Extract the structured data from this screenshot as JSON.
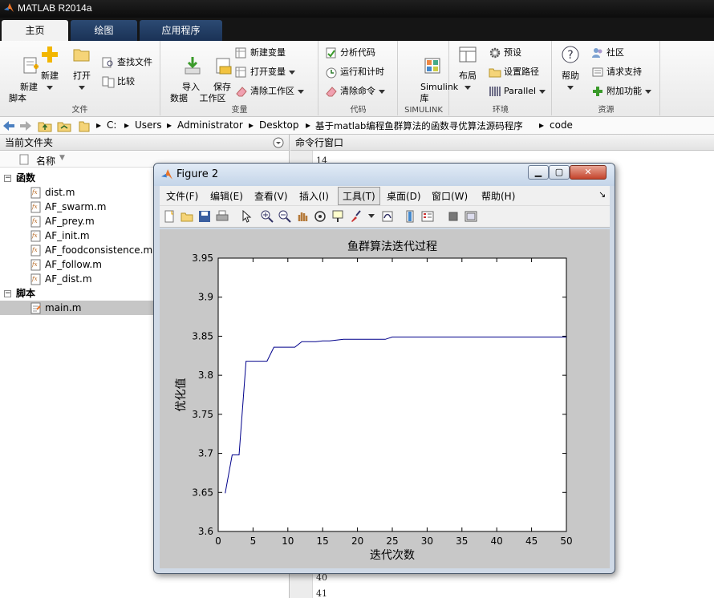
{
  "app": {
    "title": "MATLAB R2014a"
  },
  "tabs": [
    {
      "label": "主页"
    },
    {
      "label": "绘图"
    },
    {
      "label": "应用程序"
    }
  ],
  "ribbon": {
    "file_group": {
      "label": "文件",
      "new_script": "新建\n脚本",
      "new": "新建",
      "open": "打开",
      "find_files": "查找文件",
      "compare": "比较"
    },
    "var_group": {
      "label": "变量",
      "import": "导入\n数据",
      "save_ws": "保存\n工作区",
      "new_var": "新建变量",
      "open_var": "打开变量",
      "clear_ws": "清除工作区"
    },
    "code_group": {
      "label": "代码",
      "analyze": "分析代码",
      "run_time": "运行和计时",
      "clear_cmd": "清除命令"
    },
    "simulink_group": {
      "label": "SIMULINK",
      "simulink": "Simulink\n库"
    },
    "env_group": {
      "label": "环境",
      "layout": "布局",
      "prefs": "预设",
      "set_path": "设置路径",
      "parallel": "Parallel"
    },
    "res_group": {
      "label": "资源",
      "help": "帮助",
      "community": "社区",
      "support": "请求支持",
      "addons": "附加功能"
    }
  },
  "address": {
    "parts": [
      "C:",
      "Users",
      "Administrator",
      "Desktop",
      "基于matlab编程鱼群算法的函数寻优算法源码程序",
      "code"
    ]
  },
  "left_panel": {
    "title": "当前文件夹",
    "col_header": "名称",
    "sections": [
      {
        "label": "函数",
        "files": [
          "dist.m",
          "AF_swarm.m",
          "AF_prey.m",
          "AF_init.m",
          "AF_foodconsistence.m",
          "AF_follow.m",
          "AF_dist.m"
        ]
      },
      {
        "label": "脚本",
        "files": [
          "main.m"
        ]
      }
    ]
  },
  "cmd_panel": {
    "title": "命令行窗口",
    "line_top": "14",
    "line_b1": "40",
    "line_b2": "41"
  },
  "figure": {
    "title": "Figure 2",
    "menu": [
      "文件(F)",
      "编辑(E)",
      "查看(V)",
      "插入(I)",
      "工具(T)",
      "桌面(D)",
      "窗口(W)",
      "帮助(H)"
    ],
    "menu_overflow": "↘"
  },
  "chart_data": {
    "type": "line",
    "title": "鱼群算法迭代过程",
    "xlabel": "迭代次数",
    "ylabel": "优化值",
    "xlim": [
      0,
      50
    ],
    "ylim": [
      3.6,
      3.95
    ],
    "xticks": [
      "0",
      "5",
      "10",
      "15",
      "20",
      "25",
      "30",
      "35",
      "40",
      "45",
      "50"
    ],
    "yticks": [
      "3.6",
      "3.65",
      "3.7",
      "3.75",
      "3.8",
      "3.85",
      "3.9",
      "3.95"
    ],
    "grid": false,
    "series": [
      {
        "color": "#00008b",
        "x": [
          1,
          2,
          3,
          4,
          5,
          6,
          7,
          8,
          9,
          10,
          11,
          12,
          13,
          14,
          15,
          16,
          17,
          18,
          19,
          20,
          21,
          22,
          23,
          24,
          25,
          26,
          27,
          28,
          29,
          30,
          31,
          32,
          33,
          34,
          35,
          36,
          37,
          38,
          39,
          40,
          41,
          42,
          43,
          44,
          45,
          46,
          47,
          48,
          49,
          50
        ],
        "y": [
          3.649,
          3.698,
          3.698,
          3.818,
          3.818,
          3.818,
          3.818,
          3.836,
          3.836,
          3.836,
          3.836,
          3.843,
          3.843,
          3.843,
          3.844,
          3.844,
          3.845,
          3.846,
          3.846,
          3.846,
          3.846,
          3.846,
          3.846,
          3.846,
          3.849,
          3.849,
          3.849,
          3.849,
          3.849,
          3.849,
          3.849,
          3.849,
          3.849,
          3.849,
          3.849,
          3.849,
          3.849,
          3.849,
          3.849,
          3.849,
          3.849,
          3.849,
          3.849,
          3.849,
          3.849,
          3.849,
          3.849,
          3.849,
          3.849,
          3.849
        ]
      }
    ]
  }
}
